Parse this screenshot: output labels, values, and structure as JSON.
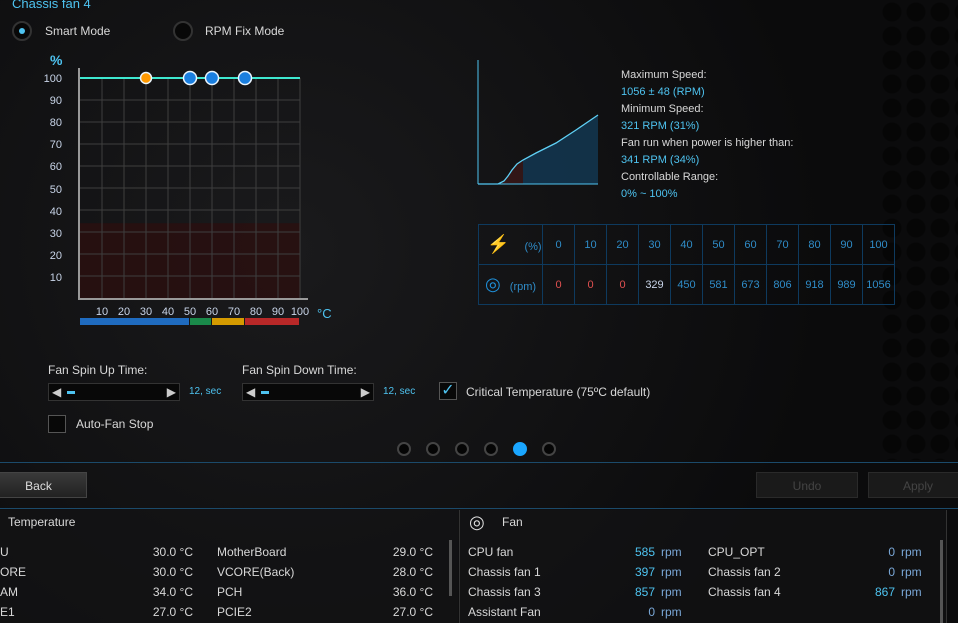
{
  "title": "Chassis fan 4",
  "modes": [
    {
      "label": "Smart Mode",
      "selected": true
    },
    {
      "label": "RPM Fix Mode",
      "selected": false
    }
  ],
  "chart_data": {
    "type": "line",
    "ylabel": "%",
    "xlabel": "°C",
    "yticks": [
      "100",
      "90",
      "80",
      "70",
      "60",
      "50",
      "40",
      "30",
      "20",
      "10"
    ],
    "xticks": [
      "10",
      "20",
      "30",
      "40",
      "50",
      "60",
      "70",
      "80",
      "90",
      "100"
    ],
    "xlim": [
      0,
      100
    ],
    "ylim": [
      0,
      100
    ],
    "points": [
      {
        "x": 30,
        "y": 100,
        "color": "#ff9900"
      },
      {
        "x": 50,
        "y": 100,
        "color": "#1a7fe0"
      },
      {
        "x": 60,
        "y": 100,
        "color": "#1a7fe0"
      },
      {
        "x": 75,
        "y": 100,
        "color": "#1a7fe0"
      }
    ],
    "line_color": "#3ee8d0",
    "stall_zone_max": 34,
    "temp_bands": [
      {
        "from": 0,
        "to": 50,
        "color": "#1f6bbf"
      },
      {
        "from": 50,
        "to": 60,
        "color": "#1a8a4a"
      },
      {
        "from": 60,
        "to": 75,
        "color": "#d49a00"
      },
      {
        "from": 75,
        "to": 100,
        "color": "#b82828"
      }
    ],
    "grid": true
  },
  "info": {
    "max_label": "Maximum Speed:",
    "max_value": "1056 ± 48 (RPM)",
    "min_label": "Minimum Speed:",
    "min_value": "321 RPM (31%)",
    "run_label": "Fan run when power is higher than:",
    "run_value": "341 RPM (34%)",
    "range_label": "Controllable Range:",
    "range_value": "0% ~ 100%"
  },
  "rpm_table": {
    "pct_unit": "(%)",
    "rpm_unit": "(rpm)",
    "pct": [
      "0",
      "10",
      "20",
      "30",
      "40",
      "50",
      "60",
      "70",
      "80",
      "90",
      "100"
    ],
    "rpm": [
      "0",
      "0",
      "0",
      "329",
      "450",
      "581",
      "673",
      "806",
      "918",
      "989",
      "1056"
    ]
  },
  "controls": {
    "spin_up_label": "Fan Spin Up Time:",
    "spin_up_value": "12, sec",
    "spin_down_label": "Fan Spin Down Time:",
    "spin_down_value": "12, sec",
    "critical_label": "Critical Temperature (75ºC default)",
    "critical_checked": true,
    "autostop_label": "Auto-Fan Stop",
    "autostop_checked": false
  },
  "pages": {
    "count": 6,
    "active": 4
  },
  "buttons": {
    "back": "Back",
    "undo": "Undo",
    "apply": "Apply"
  },
  "temperature": {
    "title": "Temperature",
    "items": [
      {
        "name": "U",
        "value": "30.0 °C"
      },
      {
        "name": "MotherBoard",
        "value": "29.0 °C"
      },
      {
        "name": "ORE",
        "value": "30.0 °C"
      },
      {
        "name": "VCORE(Back)",
        "value": "28.0 °C"
      },
      {
        "name": "AM",
        "value": "34.0 °C"
      },
      {
        "name": "PCH",
        "value": "36.0 °C"
      },
      {
        "name": "E1",
        "value": "27.0 °C"
      },
      {
        "name": "PCIE2",
        "value": "27.0 °C"
      }
    ]
  },
  "fan": {
    "title": "Fan",
    "items": [
      {
        "name": "CPU fan",
        "value": "585",
        "unit": "rpm"
      },
      {
        "name": "CPU_OPT",
        "value": "0",
        "unit": "rpm"
      },
      {
        "name": "Chassis fan 1",
        "value": "397",
        "unit": "rpm"
      },
      {
        "name": "Chassis fan 2",
        "value": "0",
        "unit": "rpm"
      },
      {
        "name": "Chassis fan 3",
        "value": "857",
        "unit": "rpm"
      },
      {
        "name": "Chassis fan 4",
        "value": "867",
        "unit": "rpm"
      },
      {
        "name": "Assistant Fan",
        "value": "0",
        "unit": "rpm"
      }
    ]
  }
}
